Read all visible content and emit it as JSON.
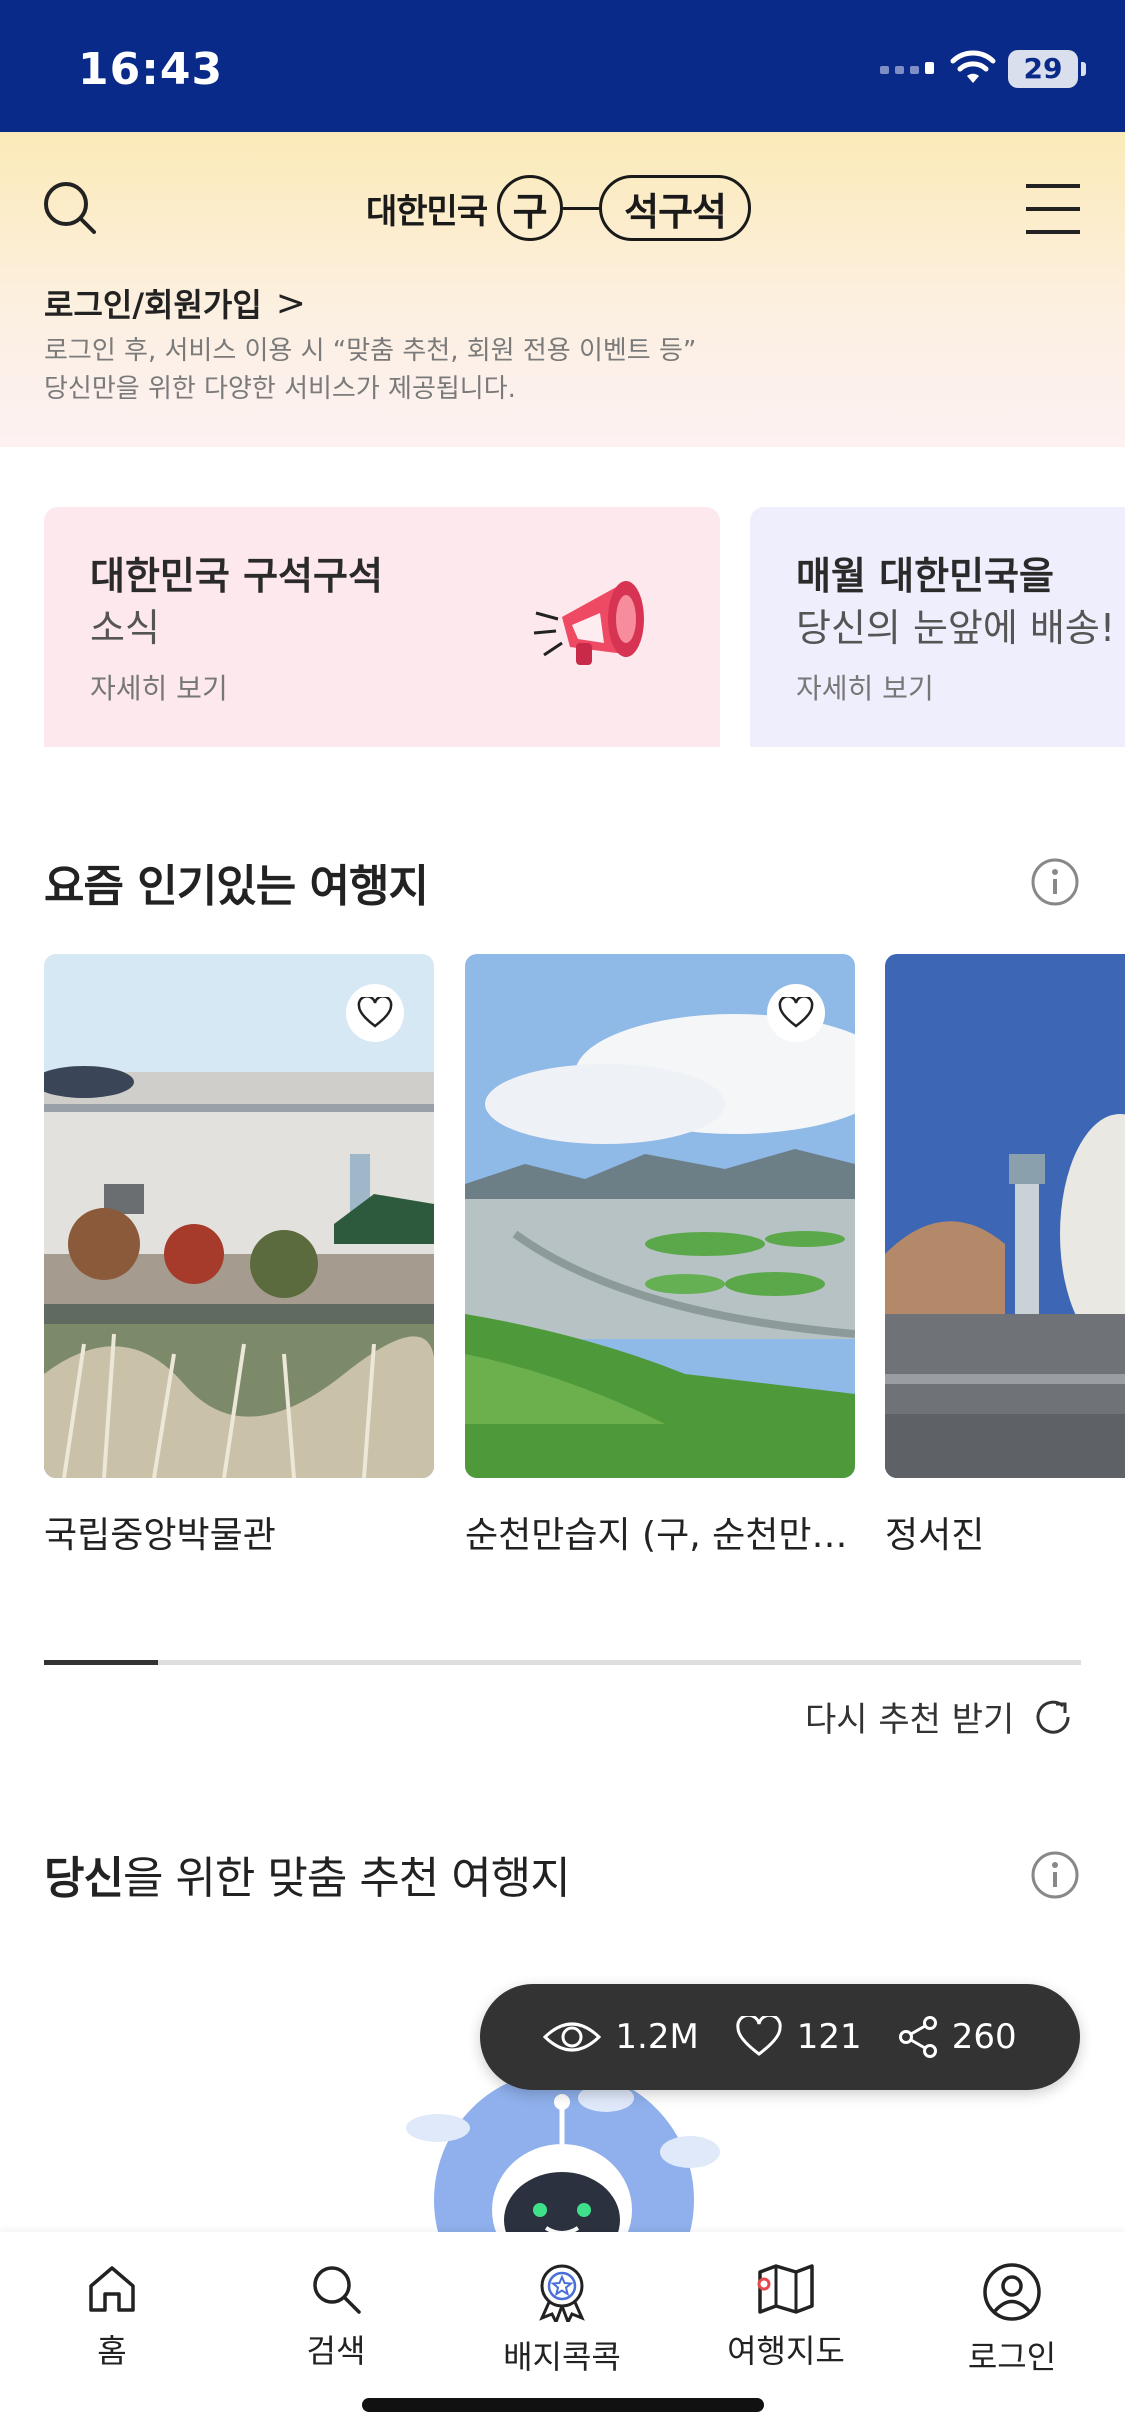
{
  "status_bar": {
    "time": "16:43",
    "battery": "29"
  },
  "header": {
    "logo": {
      "prefix": "대한민국",
      "circle_char": "구",
      "pill_text": "석구석"
    },
    "login_link": "로그인/회원가입",
    "login_desc": [
      "로그인 후, 서비스 이용 시 “맞춤 추천, 회원 전용 이벤트 등”",
      "당신만을 위한 다양한 서비스가 제공됩니다."
    ]
  },
  "banners": [
    {
      "title": "대한민국 구석구석",
      "subtitle": "소식",
      "more": "자세히 보기",
      "bg": "#fde8ed"
    },
    {
      "title": "매월 대한민국을",
      "subtitle": "당신의 눈앞에 배송!",
      "more": "자세히 보기",
      "bg": "#eeeefc"
    }
  ],
  "popular": {
    "title": "요즘 인기있는 여행지",
    "cards": [
      {
        "name": "국립중앙박물관"
      },
      {
        "name": "순천만습지 (구, 순천만자연생태공원)"
      },
      {
        "name": "정서진"
      }
    ],
    "scroll_progress": 0.11,
    "refresh_label": "다시 추천 받기"
  },
  "recommend": {
    "title_bold": "당신",
    "title_rest": "을 위한 맞춤 추천 여행지"
  },
  "stats": {
    "views": "1.2M",
    "likes": "121",
    "shares": "260"
  },
  "bottom_nav": [
    {
      "label": "홈",
      "icon": "home-icon"
    },
    {
      "label": "검색",
      "icon": "search-icon"
    },
    {
      "label": "배지콕콕",
      "icon": "badge-icon"
    },
    {
      "label": "여행지도",
      "icon": "map-icon"
    },
    {
      "label": "로그인",
      "icon": "user-icon"
    }
  ],
  "colors": {
    "status_bar": "#0a2a8a",
    "stats_pill": "#333333",
    "banner_pink": "#fde8ed",
    "banner_lavender": "#eeeefc"
  }
}
